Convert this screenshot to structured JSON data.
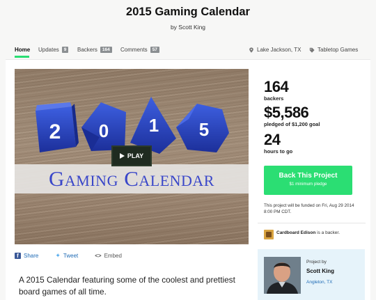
{
  "project": {
    "title": "2015 Gaming Calendar",
    "byline": "by Scott King"
  },
  "tabs": [
    {
      "label": "Home",
      "count": null
    },
    {
      "label": "Updates",
      "count": "9"
    },
    {
      "label": "Backers",
      "count": "164"
    },
    {
      "label": "Comments",
      "count": "57"
    }
  ],
  "meta": {
    "location": "Lake Jackson, TX",
    "category": "Tabletop Games"
  },
  "video": {
    "banner_text": "Gaming Calendar",
    "play_label": "PLAY",
    "dice_digits": [
      "2",
      "0",
      "1",
      "5"
    ]
  },
  "share": {
    "facebook_label": "Share",
    "twitter_label": "Tweet",
    "embed_label": "Embed"
  },
  "blurb": "A 2015 Calendar featuring some of the coolest and prettiest board games of all time.",
  "stats": {
    "backers_num": "164",
    "backers_label": "backers",
    "pledged_num": "$5,586",
    "pledged_label": "pledged of $1,200 goal",
    "hours_num": "24",
    "hours_label": "hours to go"
  },
  "back_button": {
    "label": "Back This Project",
    "sub": "$1 minimum pledge"
  },
  "funding_note": "This project will be funded on Fri, Aug 29 2014 8:00 PM CDT.",
  "recent_backer": {
    "name": "Cardboard Edison",
    "suffix": "is a backer."
  },
  "creator": {
    "label": "Project by",
    "name": "Scott King",
    "location": "Angleton, TX"
  },
  "colors": {
    "accent_green": "#2bde73",
    "link_blue": "#1f6bb5",
    "dice_blue": "#2340b8",
    "creator_panel_bg": "#e6f3fa"
  }
}
